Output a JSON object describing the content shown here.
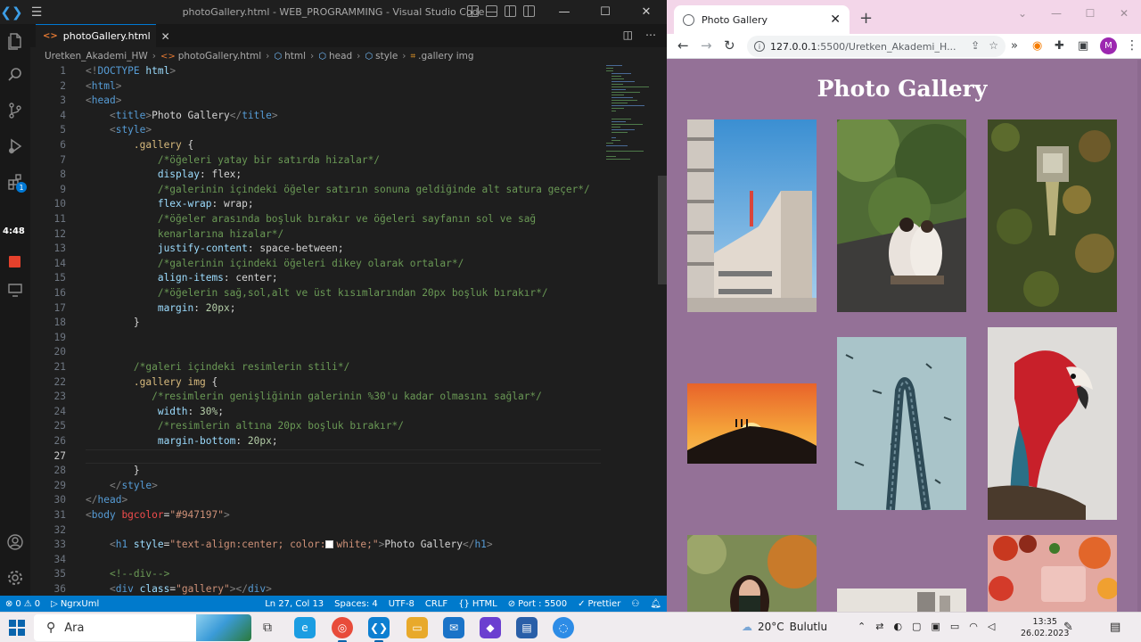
{
  "vscode": {
    "window_title": "photoGallery.html - WEB_PROGRAMMING - Visual Studio Code",
    "tab": {
      "label": "photoGallery.html",
      "close": "✕"
    },
    "breadcrumb": [
      "Uretken_Akademi_HW",
      "photoGallery.html",
      "html",
      "head",
      "style",
      ".gallery img"
    ],
    "time_overlay": "4:48",
    "explorer_badge": "1",
    "code_lines": [
      {
        "n": "1",
        "segs": [
          [
            "t-br",
            "<!"
          ],
          [
            "t-tag",
            "DOCTYPE"
          ],
          [
            "t-attr",
            " html"
          ],
          [
            "t-br",
            ">"
          ]
        ]
      },
      {
        "n": "2",
        "segs": [
          [
            "t-br",
            "<"
          ],
          [
            "t-tag",
            "html"
          ],
          [
            "t-br",
            ">"
          ]
        ]
      },
      {
        "n": "3",
        "segs": [
          [
            "t-br",
            "<"
          ],
          [
            "t-tag",
            "head"
          ],
          [
            "t-br",
            ">"
          ]
        ]
      },
      {
        "n": "4",
        "segs": [
          [
            "t-txt",
            "    "
          ],
          [
            "t-br",
            "<"
          ],
          [
            "t-tag",
            "title"
          ],
          [
            "t-br",
            ">"
          ],
          [
            "t-txt",
            "Photo Gallery"
          ],
          [
            "t-br",
            "</"
          ],
          [
            "t-tag",
            "title"
          ],
          [
            "t-br",
            ">"
          ]
        ]
      },
      {
        "n": "5",
        "segs": [
          [
            "t-txt",
            "    "
          ],
          [
            "t-br",
            "<"
          ],
          [
            "t-tag",
            "style"
          ],
          [
            "t-br",
            ">"
          ]
        ]
      },
      {
        "n": "6",
        "segs": [
          [
            "t-txt",
            "        "
          ],
          [
            "t-sel",
            ".gallery"
          ],
          [
            "t-punc",
            " {"
          ]
        ]
      },
      {
        "n": "7",
        "segs": [
          [
            "t-txt",
            "            "
          ],
          [
            "t-cmt",
            "/*öğeleri yatay bir satırda hizalar*/"
          ]
        ]
      },
      {
        "n": "8",
        "segs": [
          [
            "t-txt",
            "            "
          ],
          [
            "t-prop",
            "display"
          ],
          [
            "t-punc",
            ": "
          ],
          [
            "t-val",
            "flex"
          ],
          [
            "t-punc",
            ";"
          ]
        ]
      },
      {
        "n": "9",
        "segs": [
          [
            "t-txt",
            "            "
          ],
          [
            "t-cmt",
            "/*galerinin içindeki öğeler satırın sonuna geldiğinde alt satura geçer*/"
          ]
        ]
      },
      {
        "n": "10",
        "segs": [
          [
            "t-txt",
            "            "
          ],
          [
            "t-prop",
            "flex-wrap"
          ],
          [
            "t-punc",
            ": "
          ],
          [
            "t-val",
            "wrap"
          ],
          [
            "t-punc",
            ";"
          ]
        ]
      },
      {
        "n": "11",
        "segs": [
          [
            "t-txt",
            "            "
          ],
          [
            "t-cmt",
            "/*öğeler arasında boşluk bırakır ve öğeleri sayfanın sol ve sağ"
          ]
        ]
      },
      {
        "n": "12",
        "segs": [
          [
            "t-txt",
            "            "
          ],
          [
            "t-cmt",
            "kenarlarına hizalar*/"
          ]
        ]
      },
      {
        "n": "13",
        "segs": [
          [
            "t-txt",
            "            "
          ],
          [
            "t-prop",
            "justify-content"
          ],
          [
            "t-punc",
            ": "
          ],
          [
            "t-val",
            "space-between"
          ],
          [
            "t-punc",
            ";"
          ]
        ]
      },
      {
        "n": "14",
        "segs": [
          [
            "t-txt",
            "            "
          ],
          [
            "t-cmt",
            "/*galerinin içindeki öğeleri dikey olarak ortalar*/"
          ]
        ]
      },
      {
        "n": "15",
        "segs": [
          [
            "t-txt",
            "            "
          ],
          [
            "t-prop",
            "align-items"
          ],
          [
            "t-punc",
            ": "
          ],
          [
            "t-val",
            "center"
          ],
          [
            "t-punc",
            ";"
          ]
        ]
      },
      {
        "n": "16",
        "segs": [
          [
            "t-txt",
            "            "
          ],
          [
            "t-cmt",
            "/*öğelerin sağ,sol,alt ve üst kısımlarından 20px boşluk bırakır*/"
          ]
        ]
      },
      {
        "n": "17",
        "segs": [
          [
            "t-txt",
            "            "
          ],
          [
            "t-prop",
            "margin"
          ],
          [
            "t-punc",
            ": "
          ],
          [
            "t-num",
            "20px"
          ],
          [
            "t-punc",
            ";"
          ]
        ]
      },
      {
        "n": "18",
        "segs": [
          [
            "t-txt",
            "        "
          ],
          [
            "t-punc",
            "}"
          ]
        ]
      },
      {
        "n": "19",
        "segs": []
      },
      {
        "n": "20",
        "segs": []
      },
      {
        "n": "21",
        "segs": [
          [
            "t-txt",
            "        "
          ],
          [
            "t-cmt",
            "/*galeri içindeki resimlerin stili*/"
          ]
        ]
      },
      {
        "n": "22",
        "segs": [
          [
            "t-txt",
            "        "
          ],
          [
            "t-sel",
            ".gallery img"
          ],
          [
            "t-punc",
            " {"
          ]
        ]
      },
      {
        "n": "23",
        "segs": [
          [
            "t-txt",
            "           "
          ],
          [
            "t-cmt",
            "/*resimlerin genişliğinin galerinin %30'u kadar olmasını sağlar*/"
          ]
        ]
      },
      {
        "n": "24",
        "segs": [
          [
            "t-txt",
            "            "
          ],
          [
            "t-prop",
            "width"
          ],
          [
            "t-punc",
            ": "
          ],
          [
            "t-num",
            "30%"
          ],
          [
            "t-punc",
            ";"
          ]
        ]
      },
      {
        "n": "25",
        "segs": [
          [
            "t-txt",
            "            "
          ],
          [
            "t-cmt",
            "/*resimlerin altına 20px boşluk bırakır*/"
          ]
        ]
      },
      {
        "n": "26",
        "segs": [
          [
            "t-txt",
            "            "
          ],
          [
            "t-prop",
            "margin-bottom"
          ],
          [
            "t-punc",
            ": "
          ],
          [
            "t-num",
            "20px"
          ],
          [
            "t-punc",
            ";"
          ]
        ]
      },
      {
        "n": "27",
        "segs": []
      },
      {
        "n": "28",
        "segs": [
          [
            "t-txt",
            "        "
          ],
          [
            "t-punc",
            "}"
          ]
        ]
      },
      {
        "n": "29",
        "segs": [
          [
            "t-txt",
            "    "
          ],
          [
            "t-br",
            "</"
          ],
          [
            "t-tag",
            "style"
          ],
          [
            "t-br",
            ">"
          ]
        ]
      },
      {
        "n": "30",
        "segs": [
          [
            "t-br",
            "</"
          ],
          [
            "t-tag",
            "head"
          ],
          [
            "t-br",
            ">"
          ]
        ]
      },
      {
        "n": "31",
        "segs": [
          [
            "t-br",
            "<"
          ],
          [
            "t-tag",
            "body"
          ],
          [
            "t-bg",
            " bgcolor"
          ],
          [
            "t-punc",
            "="
          ],
          [
            "t-str",
            "\"#947197\""
          ],
          [
            "t-br",
            ">"
          ]
        ]
      },
      {
        "n": "32",
        "segs": []
      },
      {
        "n": "33",
        "segs": [
          [
            "t-txt",
            "    "
          ],
          [
            "t-br",
            "<"
          ],
          [
            "t-tag",
            "h1"
          ],
          [
            "t-attr",
            " style"
          ],
          [
            "t-punc",
            "="
          ],
          [
            "t-str",
            "\"text-align:center; color:"
          ],
          [
            "swatch",
            ""
          ],
          [
            "t-str",
            "white;\""
          ],
          [
            "t-br",
            ">"
          ],
          [
            "t-txt",
            "Photo Gallery"
          ],
          [
            "t-br",
            "</"
          ],
          [
            "t-tag",
            "h1"
          ],
          [
            "t-br",
            ">"
          ]
        ]
      },
      {
        "n": "34",
        "segs": []
      },
      {
        "n": "35",
        "segs": [
          [
            "t-txt",
            "    "
          ],
          [
            "t-cmt",
            "<!--div-->"
          ]
        ]
      },
      {
        "n": "36",
        "segs": [
          [
            "t-txt",
            "    "
          ],
          [
            "t-br",
            "<"
          ],
          [
            "t-tag",
            "div"
          ],
          [
            "t-attr",
            " class"
          ],
          [
            "t-punc",
            "="
          ],
          [
            "t-str",
            "\"gallery\""
          ],
          [
            "t-br",
            "></"
          ],
          [
            "t-tag",
            "div"
          ],
          [
            "t-br",
            ">"
          ]
        ]
      }
    ],
    "status": {
      "errors": "0",
      "warnings": "0",
      "ngrx": "NgrxUml",
      "position": "Ln 27, Col 13",
      "spaces": "Spaces: 4",
      "encoding": "UTF-8",
      "eol": "CRLF",
      "language": "HTML",
      "port": "Port : 5500",
      "prettier": "Prettier"
    }
  },
  "browser": {
    "tab_title": "Photo Gallery",
    "url_host": "127.0.0.1",
    "url_rest": ":5500/Uretken_Akademi_H...",
    "avatar_letter": "M",
    "page_heading": "Photo Gallery",
    "bg_color": "#947197"
  },
  "taskbar": {
    "search_placeholder": "Ara",
    "weather_temp": "20°C",
    "weather_desc": "Bulutlu",
    "time": "13:35",
    "date": "26.02.2023"
  }
}
